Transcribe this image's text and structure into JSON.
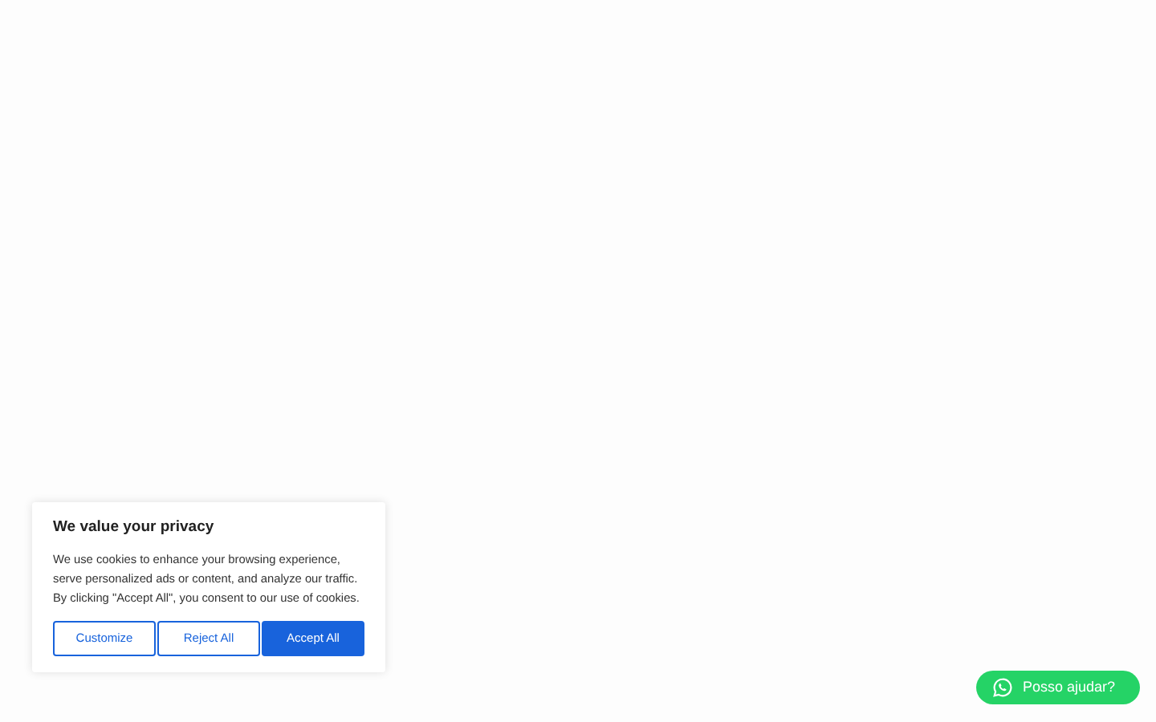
{
  "cookie_banner": {
    "title": "We value your privacy",
    "message": "We use cookies to enhance your browsing experience, serve personalized ads or content, and analyze our traffic. By clicking \"Accept All\", you consent to our use of cookies.",
    "buttons": [
      {
        "label": "Customize",
        "kind": "outline"
      },
      {
        "label": "Reject All",
        "kind": "outline"
      },
      {
        "label": "Accept All",
        "kind": "primary"
      }
    ]
  },
  "chat_button": {
    "label": "Posso ajudar?"
  }
}
